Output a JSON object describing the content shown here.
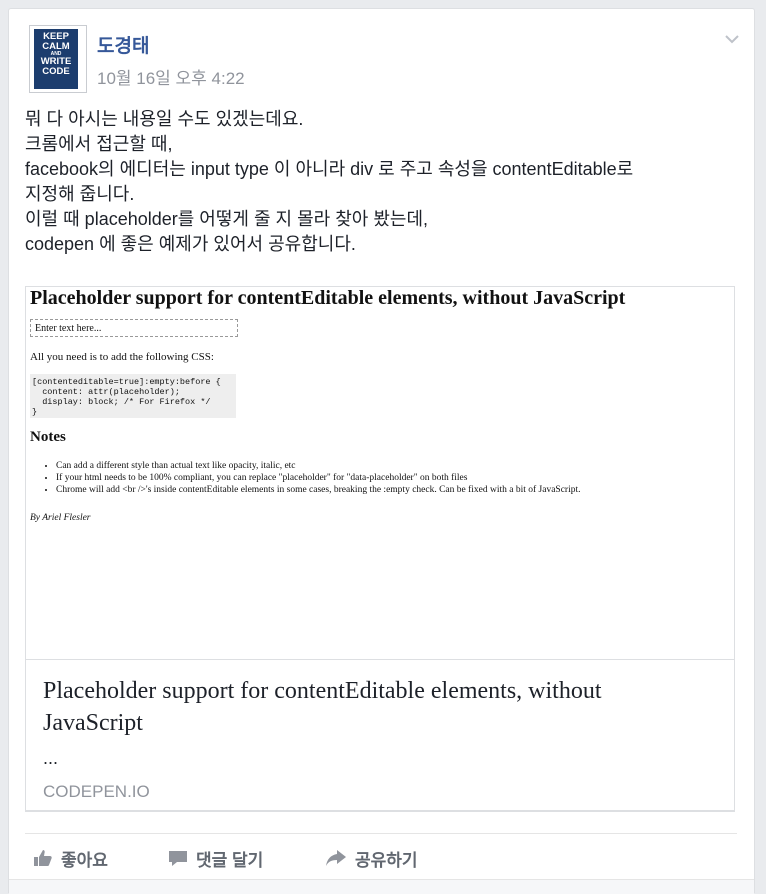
{
  "post": {
    "author": "도경태",
    "timestamp": "10월 16일 오후 4:22",
    "avatar_text": [
      "KEEP",
      "CALM",
      "AND",
      "WRITE",
      "CODE"
    ],
    "lines": [
      "뭐 다 아시는 내용일 수도 있겠는데요.",
      "크롬에서 접근할 때,",
      "facebook의 에디터는 input type 이 아니라 div 로 주고 속성을 contentEditable로",
      "지정해 줍니다.",
      "이럴 때 placeholder를 어떻게 줄 지 몰라 찾아 봤는데,",
      "codepen 에 좋은 예제가 있어서 공유합니다."
    ]
  },
  "preview": {
    "title": "Placeholder support for contentEditable elements, without JavaScript",
    "input_placeholder": "Enter text here...",
    "desc": "All you need is to add the following CSS:",
    "code": "[contenteditable=true]:empty:before {\n  content: attr(placeholder);\n  display: block; /* For Firefox */\n}",
    "notes_heading": "Notes",
    "notes": [
      "Can add a different style than actual text like opacity, italic, etc",
      "If your html needs to be 100% compliant, you can replace \"placeholder\" for \"data-placeholder\" on both files",
      "Chrome will add <br />'s inside contentEditable elements in some cases, breaking the :empty check. Can be fixed with a bit of JavaScript."
    ],
    "byline": "By Ariel Flesler"
  },
  "link": {
    "title": "Placeholder support for contentEditable elements, without JavaScript",
    "description": "...",
    "domain": "CODEPEN.IO"
  },
  "actions": {
    "like": "좋아요",
    "comment": "댓글 달기",
    "share": "공유하기"
  },
  "colors": {
    "author_link": "#365899",
    "meta_gray": "#90949c",
    "action_gray": "#616770",
    "background": "#e9ebee"
  }
}
